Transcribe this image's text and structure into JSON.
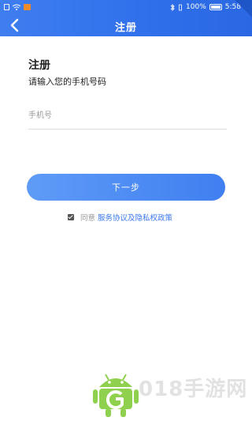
{
  "status_bar": {
    "battery": "100%",
    "time": "5:58"
  },
  "nav": {
    "title": "注册"
  },
  "form": {
    "heading": "注册",
    "subheading": "请输入您的手机号码",
    "phone_placeholder": "手机号",
    "phone_value": ""
  },
  "actions": {
    "next_label": "下一步"
  },
  "agreement": {
    "checked": true,
    "prefix": "同意",
    "link": "服务协议及隐私权政策"
  },
  "watermark": {
    "text": "018手游网"
  },
  "colors": {
    "primary": "#3f7ef0",
    "link": "#3a78ef",
    "watermark_green": "#8fd14f"
  }
}
